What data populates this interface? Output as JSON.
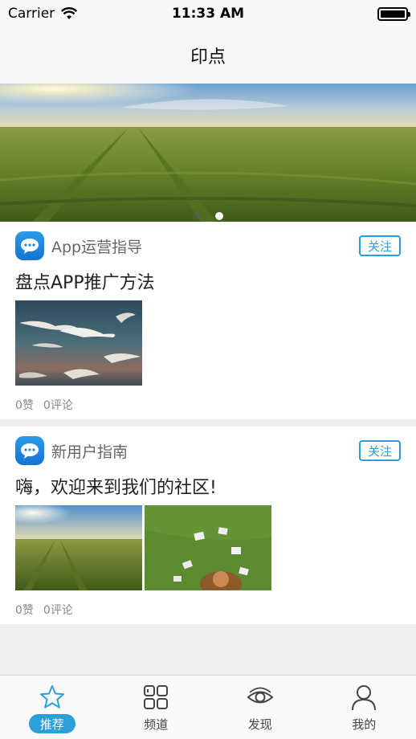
{
  "status": {
    "carrier": "Carrier",
    "time": "11:33 AM"
  },
  "nav": {
    "title": "印点"
  },
  "banner": {
    "slides": 2,
    "active_slide": 2
  },
  "posts": [
    {
      "channel": "App运营指导",
      "follow_label": "关注",
      "title": "盘点APP推广方法",
      "likes": "0赞",
      "comments": "0评论"
    },
    {
      "channel": "新用户指南",
      "follow_label": "关注",
      "title": "嗨，欢迎来到我们的社区!",
      "likes": "0赞",
      "comments": "0评论"
    }
  ],
  "tabs": [
    {
      "label": "推荐",
      "icon": "star-icon",
      "active": true
    },
    {
      "label": "频道",
      "icon": "grid-icon",
      "active": false
    },
    {
      "label": "发现",
      "icon": "eye-icon",
      "active": false
    },
    {
      "label": "我的",
      "icon": "person-icon",
      "active": false
    }
  ],
  "colors": {
    "accent": "#2a9fd8",
    "channel_icon": "#1e87dc"
  }
}
